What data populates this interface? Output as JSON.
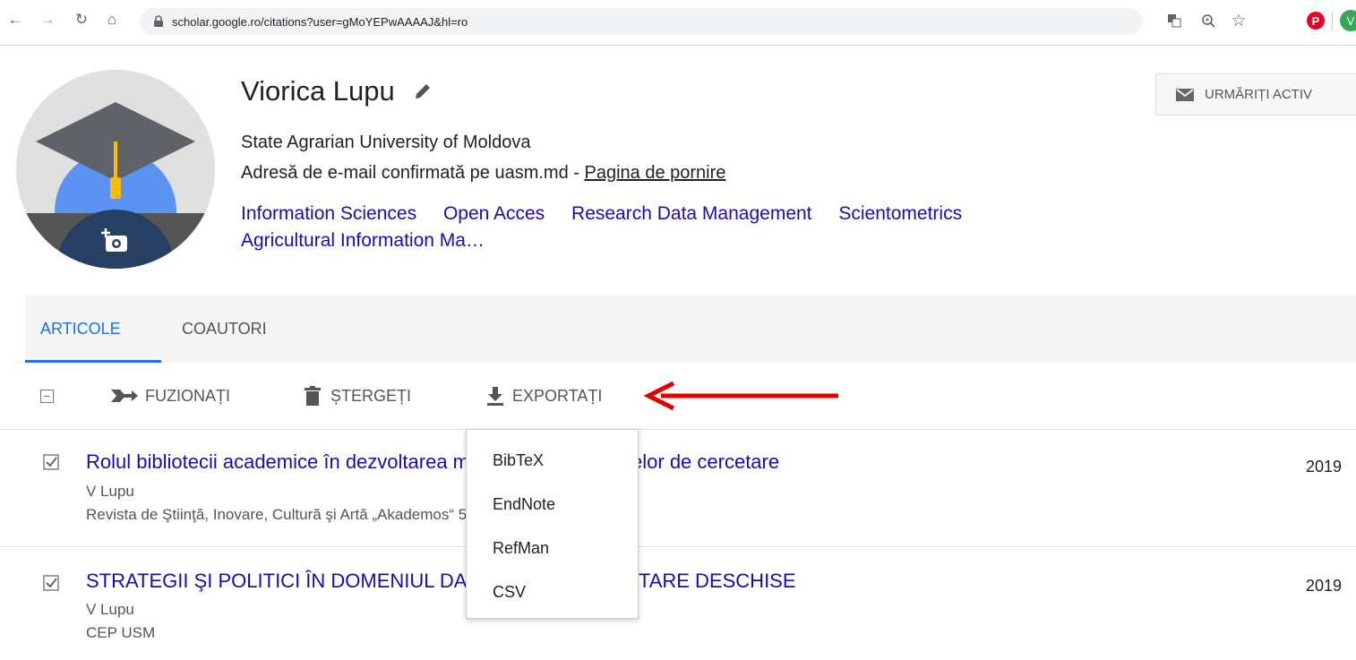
{
  "browser": {
    "url": "scholar.google.ro/citations?user=gMoYEPwAAAAJ&hl=ro",
    "profile_initial": "V",
    "icons": [
      "back-icon",
      "forward-icon",
      "reload-icon",
      "home-icon",
      "lock-icon",
      "translate-icon",
      "zoom-icon",
      "star-icon",
      "pinterest-icon"
    ]
  },
  "profile": {
    "name": "Viorica Lupu",
    "affiliation": "State Agrarian University of Moldova",
    "email_text": "Adresă de e-mail confirmată pe uasm.md - ",
    "homepage_label": "Pagina de pornire",
    "interests": [
      "Information Sciences",
      "Open Acces",
      "Research Data Management",
      "Scientometrics",
      "Agricultural Information Ma…"
    ],
    "follow_label": "URMĂRIȚI ACTIV"
  },
  "tabs": [
    {
      "label": "ARTICOLE",
      "active": true
    },
    {
      "label": "COAUTORI",
      "active": false
    }
  ],
  "toolbar": {
    "merge_label": "FUZIONAȚI",
    "delete_label": "ȘTERGEȚI",
    "export_label": "EXPORTAȚI"
  },
  "export_menu": {
    "items": [
      "BibTeX",
      "EndNote",
      "RefMan",
      "CSV"
    ]
  },
  "articles": [
    {
      "title": "Rolul bibliotecii academice în dezvoltarea managementului datelor de cercetare",
      "authors": "V Lupu",
      "venue": "Revista de Ştiinţă, Inovare, Cultură şi Artă „Akademos“ 52 (1), 146-149",
      "year": "2019",
      "checked": true
    },
    {
      "title": "STRATEGII ŞI POLITICI ÎN DOMENIUL DATELOR DE CERCETARE DESCHISE",
      "authors": "V Lupu",
      "venue": "CEP USM",
      "year": "2019",
      "checked": true
    }
  ],
  "colors": {
    "link": "#1a0dab",
    "tab_active": "#1a73e8",
    "annotation_arrow": "#e00000"
  }
}
